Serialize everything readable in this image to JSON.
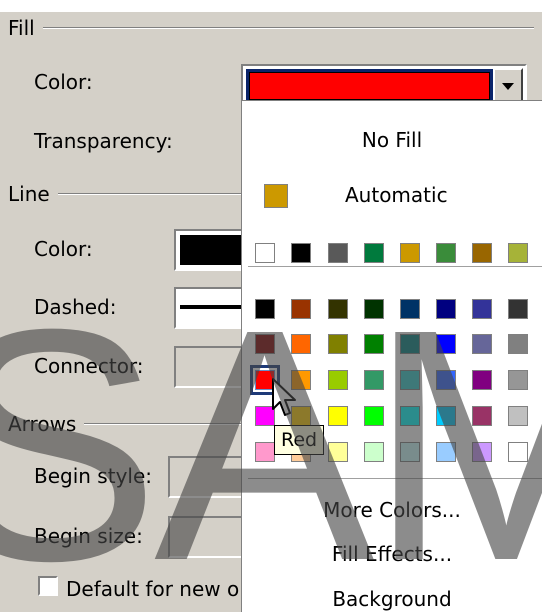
{
  "fill": {
    "section": "Fill",
    "color_label": "Color:",
    "color_value": "#ff0000",
    "transparency_label": "Transparency:"
  },
  "line": {
    "section": "Line",
    "color_label": "Color:",
    "dashed_label": "Dashed:",
    "connector_label": "Connector:"
  },
  "arrows": {
    "section": "Arrows",
    "begin_style_label": "Begin style:",
    "begin_size_label": "Begin size:",
    "default_checkbox_label": "Default for new ob"
  },
  "popup": {
    "no_fill": "No Fill",
    "automatic": "Automatic",
    "automatic_color": "#cc9900",
    "recent_colors": [
      "#ffffff",
      "#000000",
      "#595959",
      "#007a3d",
      "#cc9900",
      "#3a8c3a",
      "#996600",
      "#a6b338"
    ],
    "palette": [
      [
        "#000000",
        "#993300",
        "#333300",
        "#003300",
        "#003366",
        "#000080",
        "#333399",
        "#333333"
      ],
      [
        "#800000",
        "#ff6600",
        "#808000",
        "#008000",
        "#008080",
        "#0000ff",
        "#666699",
        "#808080"
      ],
      [
        "#ff0000",
        "#ff9900",
        "#99cc00",
        "#339966",
        "#33cccc",
        "#3366ff",
        "#800080",
        "#969696"
      ],
      [
        "#ff00ff",
        "#ffcc00",
        "#ffff00",
        "#00ff00",
        "#00ffff",
        "#00ccff",
        "#993366",
        "#c0c0c0"
      ],
      [
        "#ff99cc",
        "#ffcc99",
        "#ffff99",
        "#ccffcc",
        "#ccffff",
        "#99ccff",
        "#cc99ff",
        "#ffffff"
      ]
    ],
    "selected_color": "Red",
    "more_colors": "More Colors...",
    "fill_effects": "Fill Effects...",
    "background": "Background"
  },
  "tooltip": "Red",
  "watermark": "SAM"
}
